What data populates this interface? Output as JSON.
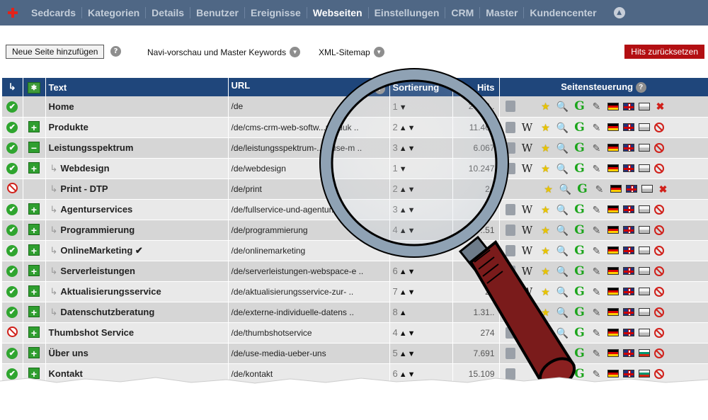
{
  "nav": {
    "items": [
      "Sedcards",
      "Kategorien",
      "Details",
      "Benutzer",
      "Ereignisse",
      "Webseiten",
      "Einstellungen",
      "CRM",
      "Master",
      "Kundencenter"
    ],
    "active_index": 5
  },
  "toolbar": {
    "add_label": "Neue Seite hinzufügen",
    "navi_label": "Navi-vorschau und Master Keywords",
    "sitemap_label": "XML-Sitemap",
    "reset_label": "Hits zurücksetzen"
  },
  "table": {
    "headers": {
      "text": "Text",
      "url": "URL",
      "sort": "Sortierung",
      "hits": "Hits",
      "controls": "Seitensteuerung"
    },
    "rows": [
      {
        "status": "ok",
        "tree": "",
        "indent": false,
        "title": "Home",
        "url": "/de",
        "sort_num": "1",
        "sort_arrows": "▼",
        "hits": "248.3..",
        "book": true,
        "wiki": false,
        "star": "★",
        "mag": true,
        "g": true,
        "lang3": "gray",
        "del": "x"
      },
      {
        "status": "ok",
        "tree": "+",
        "indent": false,
        "title": "Produkte",
        "url": "/de/cms-crm-web-softw...produk ..",
        "sort_num": "2",
        "sort_arrows": "▲▼",
        "hits": "11.467",
        "book": true,
        "wiki": true,
        "star": "★",
        "mag": true,
        "g": true,
        "lang3": "gray",
        "del": "no"
      },
      {
        "status": "ok",
        "tree": "−",
        "indent": false,
        "title": "Leistungsspektrum",
        "url": "/de/leistungsspektrum-...n-use-m ..",
        "sort_num": "3",
        "sort_arrows": "▲▼",
        "hits": "6.067",
        "book": true,
        "wiki": true,
        "star": "★",
        "mag": true,
        "g": true,
        "lang3": "gray",
        "del": "no"
      },
      {
        "status": "ok",
        "tree": "+",
        "indent": true,
        "title": "Webdesign",
        "url": "/de/webdesign",
        "sort_num": "1",
        "sort_arrows": "▼",
        "hits": "10.247",
        "book": true,
        "wiki": true,
        "star": "★",
        "mag": true,
        "g": true,
        "lang3": "gray",
        "del": "no"
      },
      {
        "status": "off",
        "tree": "",
        "indent": true,
        "title": "Print - DTP",
        "url": "/de/print",
        "sort_num": "2",
        "sort_arrows": "▲▼",
        "hits": "2..",
        "book": false,
        "wiki": false,
        "star": "★",
        "mag": true,
        "g": true,
        "lang3": "gray",
        "del": "x"
      },
      {
        "status": "ok",
        "tree": "+",
        "indent": true,
        "title": "Agenturservices",
        "url": "/de/fullservice-und-agentur...",
        "sort_num": "3",
        "sort_arrows": "▲▼",
        "hits": "",
        "book": true,
        "wiki": true,
        "star": "★",
        "mag": true,
        "g": true,
        "lang3": "gray",
        "del": "no"
      },
      {
        "status": "ok",
        "tree": "+",
        "indent": true,
        "title": "Programmierung",
        "url": "/de/programmierung",
        "sort_num": "4",
        "sort_arrows": "▲▼",
        "hits": "..51",
        "book": true,
        "wiki": true,
        "star": "★",
        "mag": true,
        "g": true,
        "lang3": "gray",
        "del": "no"
      },
      {
        "status": "ok",
        "tree": "+",
        "indent": true,
        "title": "OnlineMarketing ✔",
        "url": "/de/onlinemarketing",
        "sort_num": "",
        "sort_arrows": "",
        "hits": "",
        "book": true,
        "wiki": true,
        "star": "★",
        "mag": true,
        "g": true,
        "lang3": "gray",
        "del": "no"
      },
      {
        "status": "ok",
        "tree": "+",
        "indent": true,
        "title": "Serverleistungen",
        "url": "/de/serverleistungen-webspace-e ..",
        "sort_num": "6",
        "sort_arrows": "▲▼",
        "hits": "",
        "book": true,
        "wiki": true,
        "star": "★",
        "mag": true,
        "g": true,
        "lang3": "gray",
        "del": "no"
      },
      {
        "status": "ok",
        "tree": "+",
        "indent": true,
        "title": "Aktualisierungsservice",
        "url": "/de/aktualisierungsservice-zur- ..",
        "sort_num": "7",
        "sort_arrows": "▲▼",
        "hits": "2..",
        "book": true,
        "wiki": true,
        "star": "★",
        "mag": true,
        "g": true,
        "lang3": "gray",
        "del": "no"
      },
      {
        "status": "ok",
        "tree": "+",
        "indent": true,
        "title": "Datenschutzberatung",
        "url": "/de/externe-individuelle-datens ..",
        "sort_num": "8",
        "sort_arrows": "▲",
        "hits": "1.31..",
        "book": true,
        "wiki": true,
        "star": "★",
        "mag": true,
        "g": true,
        "lang3": "gray",
        "del": "no"
      },
      {
        "status": "off",
        "tree": "+",
        "indent": false,
        "title": "Thumbshot Service",
        "url": "/de/thumbshotservice",
        "sort_num": "4",
        "sort_arrows": "▲▼",
        "hits": "274",
        "book": true,
        "wiki": false,
        "star": "★",
        "mag": true,
        "g": true,
        "lang3": "gray",
        "del": "no"
      },
      {
        "status": "ok",
        "tree": "+",
        "indent": false,
        "title": "Über uns",
        "url": "/de/use-media-ueber-uns",
        "sort_num": "5",
        "sort_arrows": "▲▼",
        "hits": "7.691",
        "book": true,
        "wiki": false,
        "star": "★",
        "mag": true,
        "g": true,
        "lang3": "bg",
        "del": "no"
      },
      {
        "status": "ok",
        "tree": "+",
        "indent": false,
        "title": "Kontakt",
        "url": "/de/kontakt",
        "sort_num": "6",
        "sort_arrows": "▲▼",
        "hits": "15.109",
        "book": true,
        "wiki": false,
        "star": "★",
        "mag": true,
        "g": true,
        "lang3": "bg",
        "del": "no"
      }
    ]
  },
  "colors": {
    "nav_bg": "#4f6785",
    "header_bg": "#1f467b",
    "reset_bg": "#b30f12",
    "ok_green": "#2fa52f",
    "off_red": "#d0201a"
  }
}
